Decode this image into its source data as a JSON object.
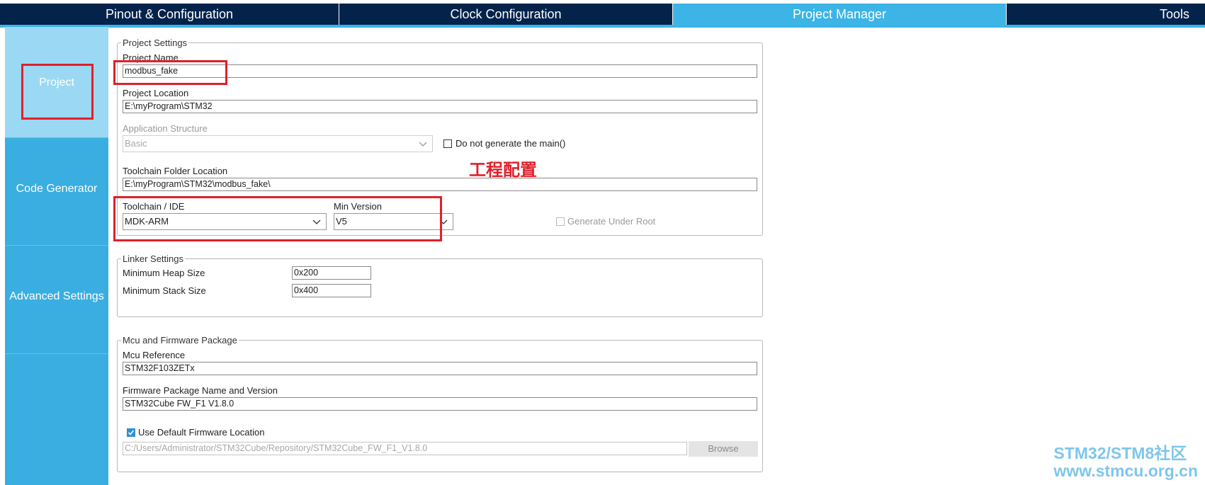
{
  "tabs": [
    {
      "label": "Pinout & Configuration",
      "active": false
    },
    {
      "label": "Clock Configuration",
      "active": false
    },
    {
      "label": "Project Manager",
      "active": true
    },
    {
      "label": "Tools",
      "active": false
    }
  ],
  "sidebar": {
    "items": [
      {
        "label": "Project",
        "active": true
      },
      {
        "label": "Code Generator",
        "active": false
      },
      {
        "label": "Advanced Settings",
        "active": false
      }
    ]
  },
  "project_settings": {
    "legend": "Project Settings",
    "project_name_label": "Project Name",
    "project_name_value": "modbus_fake",
    "project_location_label": "Project Location",
    "project_location_value": "E:\\myProgram\\STM32",
    "app_structure_label": "Application Structure",
    "app_structure_value": "Basic",
    "do_not_generate_main_label": "Do not generate the main()",
    "toolchain_folder_label": "Toolchain Folder Location",
    "toolchain_folder_value": "E:\\myProgram\\STM32\\modbus_fake\\",
    "toolchain_ide_label": "Toolchain / IDE",
    "toolchain_ide_value": "MDK-ARM",
    "min_version_label": "Min Version",
    "min_version_value": "V5",
    "generate_under_root_label": "Generate Under Root"
  },
  "linker_settings": {
    "legend": "Linker Settings",
    "heap_label": "Minimum Heap Size",
    "heap_value": "0x200",
    "stack_label": "Minimum Stack Size",
    "stack_value": "0x400"
  },
  "mcu_firmware": {
    "legend": "Mcu and Firmware Package",
    "mcu_reference_label": "Mcu Reference",
    "mcu_reference_value": "STM32F103ZETx",
    "firmware_label": "Firmware Package Name and Version",
    "firmware_value": "STM32Cube FW_F1 V1.8.0",
    "use_default_label": "Use Default Firmware Location",
    "use_default_checked": true,
    "firmware_path": "C:/Users/Administrator/STM32Cube/Repository/STM32Cube_FW_F1_V1.8.0",
    "browse_label": "Browse"
  },
  "annotation": {
    "text": "工程配置",
    "color": "#e0202a"
  },
  "watermark": {
    "line1": "STM32/STM8社区",
    "line2": "www.stmcu.org.cn"
  },
  "colors": {
    "nav_dark": "#03234b",
    "accent": "#3cb4e6",
    "sidebar": "#3aaee0",
    "sidebar_active": "#9bd8f3"
  },
  "icons": [
    "chevron-down-icon",
    "checkmark-icon"
  ]
}
